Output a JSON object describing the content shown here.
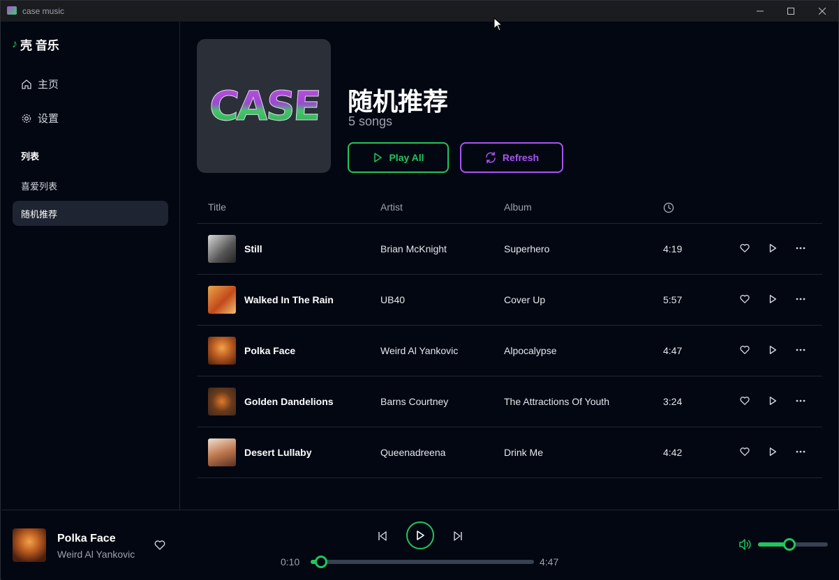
{
  "window": {
    "title": "case music"
  },
  "sidebar": {
    "logo": "壳 音乐",
    "nav": [
      {
        "label": "主页",
        "icon": "home-icon"
      },
      {
        "label": "设置",
        "icon": "gear-icon"
      }
    ],
    "section_title": "列表",
    "playlists": [
      {
        "label": "喜爱列表"
      },
      {
        "label": "随机推荐",
        "selected": true
      }
    ]
  },
  "header": {
    "cover_text": "CASE",
    "title": "随机推荐",
    "count": "5 songs",
    "play_all": "Play All",
    "refresh": "Refresh"
  },
  "table": {
    "columns": {
      "title": "Title",
      "artist": "Artist",
      "album": "Album",
      "duration_icon": "clock-icon"
    },
    "rows": [
      {
        "title": "Still",
        "artist": "Brian McKnight",
        "album": "Superhero",
        "duration": "4:19"
      },
      {
        "title": "Walked In The Rain",
        "artist": "UB40",
        "album": "Cover Up",
        "duration": "5:57"
      },
      {
        "title": "Polka Face",
        "artist": "Weird Al Yankovic",
        "album": "Alpocalypse",
        "duration": "4:47"
      },
      {
        "title": "Golden Dandelions",
        "artist": "Barns Courtney",
        "album": "The Attractions Of Youth",
        "duration": "3:24"
      },
      {
        "title": "Desert Lullaby",
        "artist": "Queenadreena",
        "album": "Drink Me",
        "duration": "4:42"
      }
    ]
  },
  "player": {
    "title": "Polka Face",
    "artist": "Weird Al Yankovic",
    "current_time": "0:10",
    "total_time": "4:47",
    "progress": 0.035,
    "volume": 0.45
  },
  "colors": {
    "accent_green": "#22c55e",
    "accent_purple": "#a855f7",
    "background": "#030712"
  }
}
